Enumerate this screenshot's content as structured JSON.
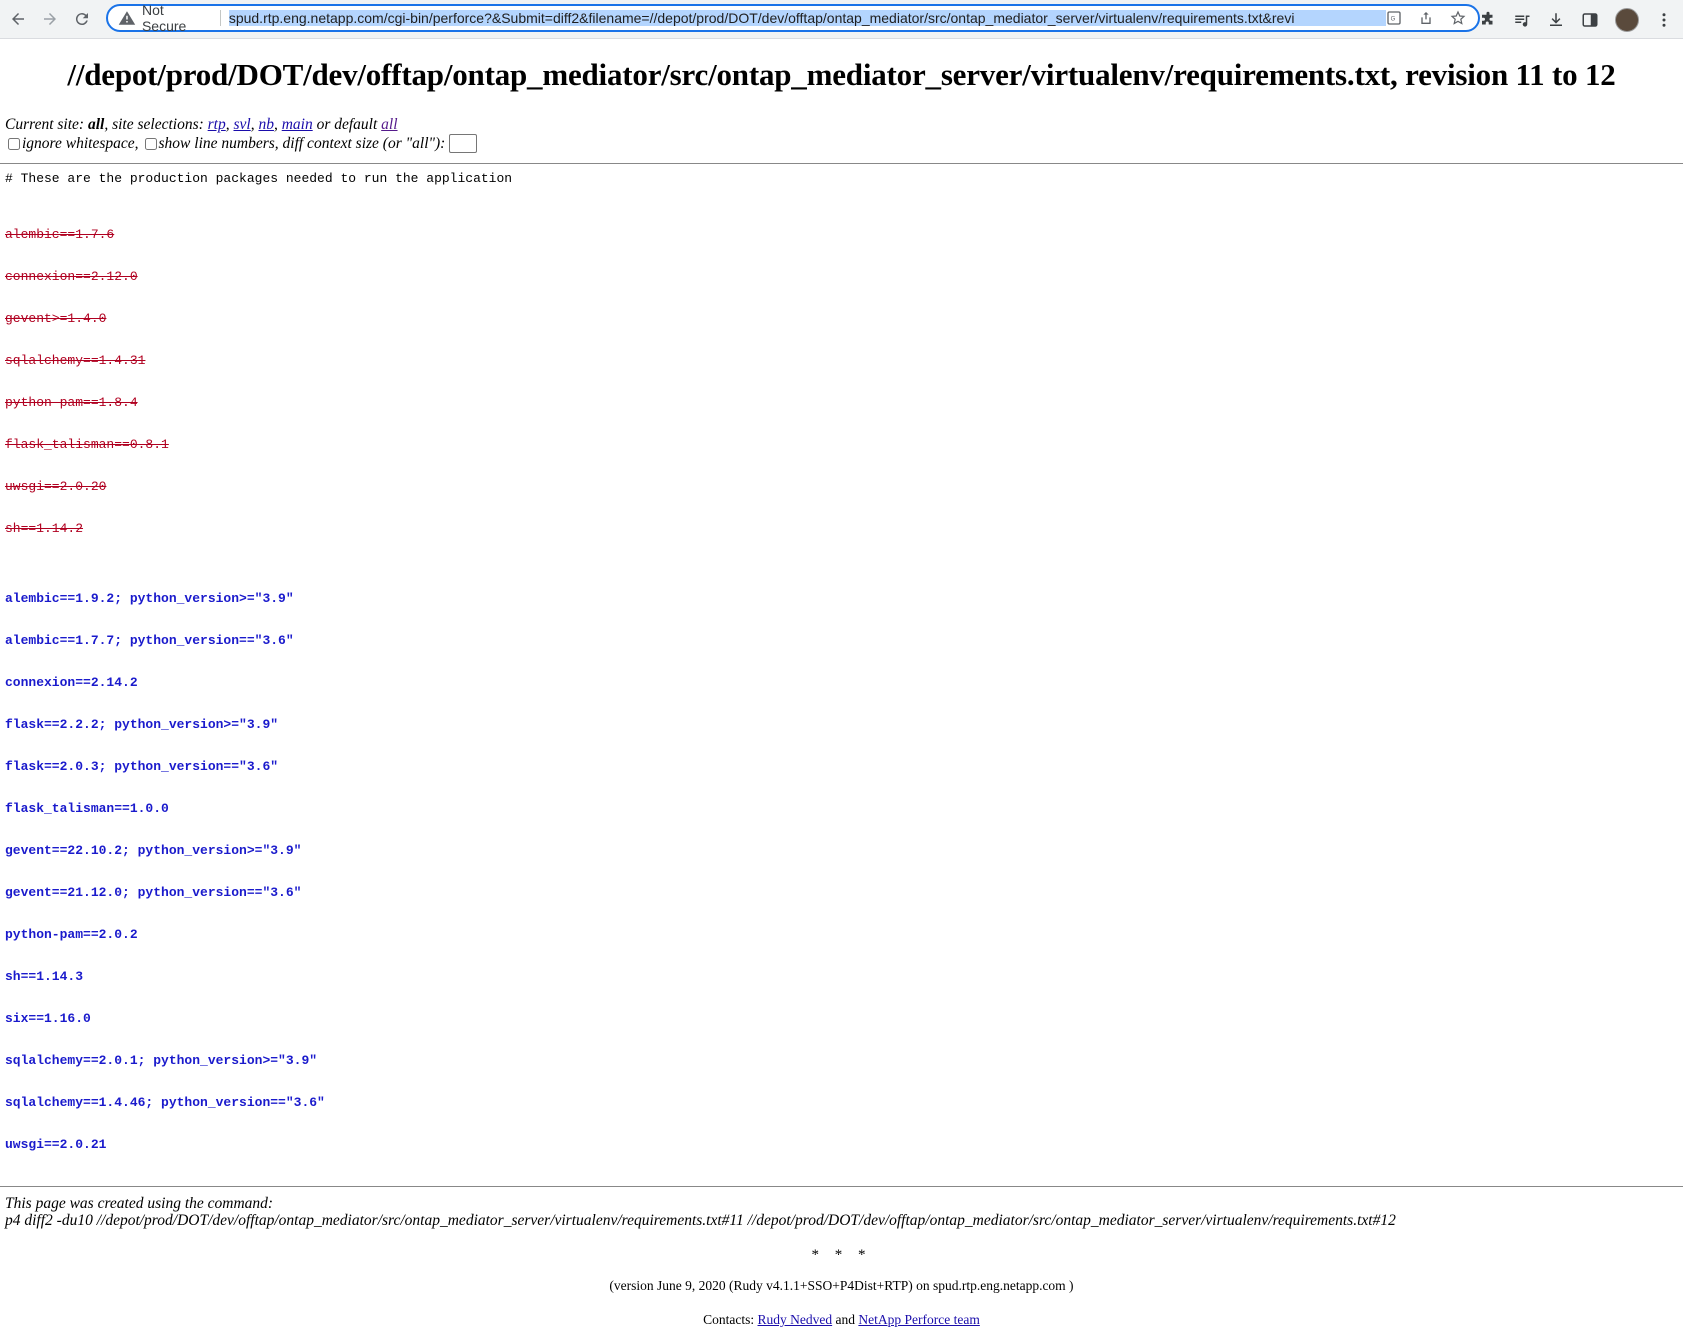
{
  "browser": {
    "security_label": "Not Secure",
    "url": "spud.rtp.eng.netapp.com/cgi-bin/perforce?&Submit=diff2&filename=//depot/prod/DOT/dev/offtap/ontap_mediator/src/ontap_mediator_server/virtualenv/requirements.txt&revi"
  },
  "page": {
    "title": "//depot/prod/DOT/dev/offtap/ontap_mediator/src/ontap_mediator_server/virtualenv/requirements.txt, revision 11 to 12",
    "site_prefix": "Current site: ",
    "site_current": "all",
    "site_middle": ", site selections: ",
    "sites": [
      "rtp",
      "svl",
      "nb",
      "main"
    ],
    "site_default_text": " or default ",
    "site_default": "all",
    "ignore_ws_label": "ignore whitespace,",
    "line_numbers_label": "show line numbers, diff context size (or \"all\"):",
    "context_value": ""
  },
  "diff": {
    "comment": "# These are the production packages needed to run the application",
    "removed": [
      "alembic==1.7.6",
      "connexion==2.12.0",
      "gevent>=1.4.0",
      "sqlalchemy==1.4.31",
      "python-pam==1.8.4",
      "flask_talisman==0.8.1",
      "uwsgi==2.0.20",
      "sh==1.14.2"
    ],
    "added": [
      "alembic==1.9.2; python_version>=\"3.9\"",
      "alembic==1.7.7; python_version==\"3.6\"",
      "connexion==2.14.2",
      "flask==2.2.2; python_version>=\"3.9\"",
      "flask==2.0.3; python_version==\"3.6\"",
      "flask_talisman==1.0.0",
      "gevent==22.10.2; python_version>=\"3.9\"",
      "gevent==21.12.0; python_version==\"3.6\"",
      "python-pam==2.0.2",
      "sh==1.14.3",
      "six==1.16.0",
      "sqlalchemy==2.0.1; python_version>=\"3.9\"",
      "sqlalchemy==1.4.46; python_version==\"3.6\"",
      "uwsgi==2.0.21"
    ]
  },
  "footer": {
    "command_intro": "This page was created using the command:",
    "command": "p4 diff2 -du10 //depot/prod/DOT/dev/offtap/ontap_mediator/src/ontap_mediator_server/virtualenv/requirements.txt#11 //depot/prod/DOT/dev/offtap/ontap_mediator/src/ontap_mediator_server/virtualenv/requirements.txt#12",
    "stars": "* * *",
    "version": "(version June 9, 2020 (Rudy v4.1.1+SSO+P4Dist+RTP) on spud.rtp.eng.netapp.com )",
    "contacts_label": "Contacts: ",
    "contact1": "Rudy Nedved",
    "and": " and ",
    "contact2": "NetApp Perforce team"
  }
}
